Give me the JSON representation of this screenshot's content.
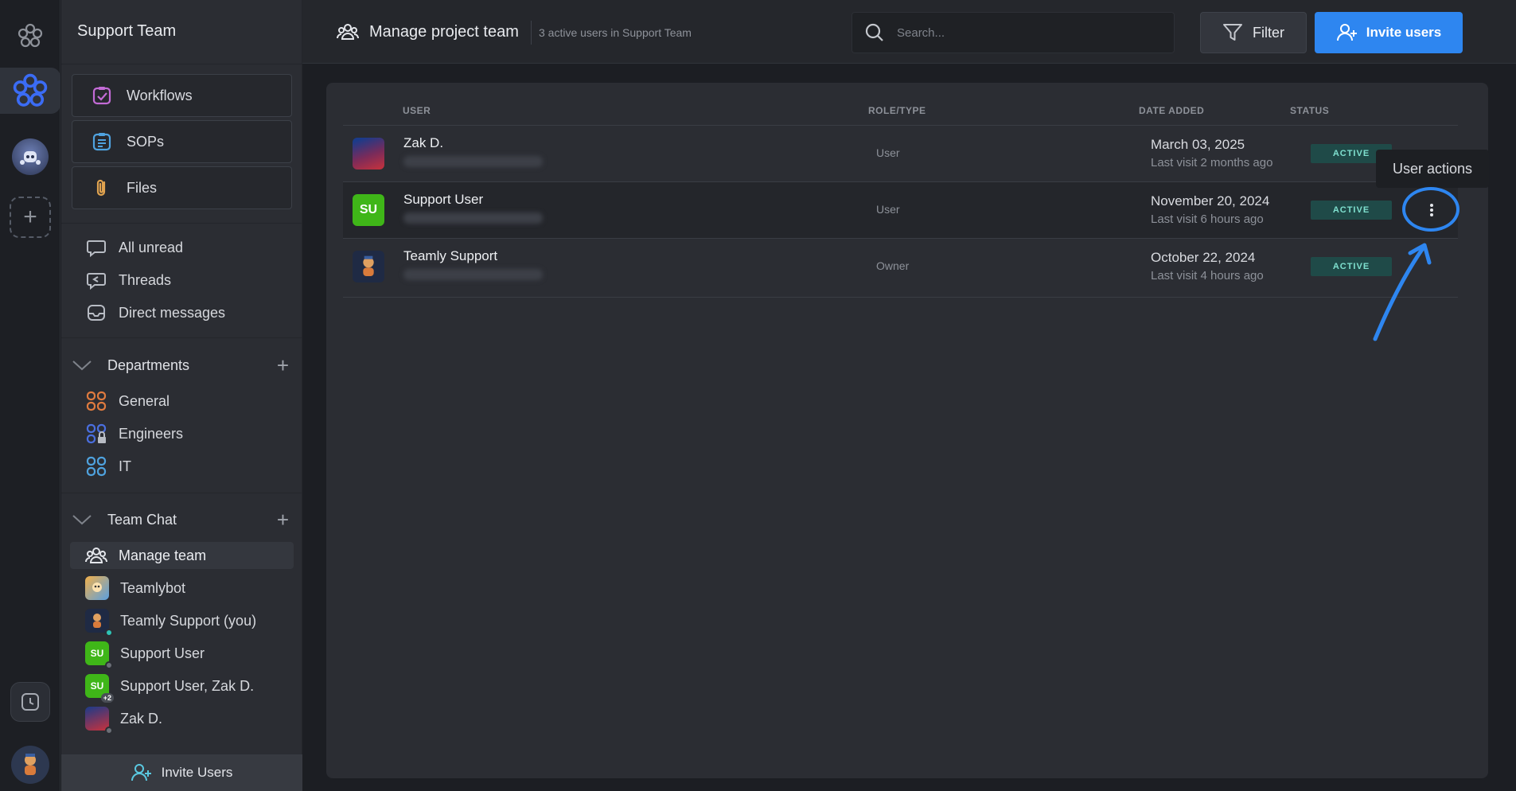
{
  "sidebar": {
    "team_name": "Support Team",
    "cards": [
      {
        "label": "Workflows",
        "icon": "workflows-icon",
        "color": "#c36bd6"
      },
      {
        "label": "SOPs",
        "icon": "sops-icon",
        "color": "#4fa3e0"
      },
      {
        "label": "Files",
        "icon": "paperclip-icon",
        "color": "#e0a34f"
      }
    ],
    "inbox": [
      {
        "label": "All unread",
        "icon": "chat-bubble-icon"
      },
      {
        "label": "Threads",
        "icon": "threads-icon"
      },
      {
        "label": "Direct messages",
        "icon": "inbox-icon"
      }
    ],
    "departments": {
      "title": "Departments",
      "items": [
        {
          "label": "General",
          "icon": "department-icon",
          "color": "#e07b3f"
        },
        {
          "label": "Engineers",
          "icon": "department-locked-icon",
          "color": "#4a6fe0"
        },
        {
          "label": "IT",
          "icon": "department-icon",
          "color": "#4fa3e0"
        }
      ]
    },
    "team_chat": {
      "title": "Team Chat",
      "items": [
        {
          "label": "Manage team",
          "kind": "icon"
        },
        {
          "label": "Teamlybot",
          "kind": "avatar"
        },
        {
          "label": "Teamly Support (you)",
          "kind": "avatar"
        },
        {
          "label": "Support User",
          "kind": "initials",
          "initials": "SU"
        },
        {
          "label": "Support User, Zak D.",
          "kind": "initials",
          "initials": "SU",
          "extra": "+2"
        },
        {
          "label": "Zak D.",
          "kind": "avatar"
        }
      ]
    },
    "footer_label": "Invite Users"
  },
  "header": {
    "title": "Manage project team",
    "subtitle": "3 active users in Support Team",
    "search_placeholder": "Search...",
    "filter_label": "Filter",
    "invite_label": "Invite users"
  },
  "table": {
    "columns": [
      "USER",
      "ROLE/TYPE",
      "DATE ADDED",
      "STATUS"
    ],
    "rows": [
      {
        "name": "Zak D.",
        "role": "User",
        "date": "March 03, 2025",
        "visit": "Last visit 2 months ago",
        "status": "ACTIVE"
      },
      {
        "name": "Support User",
        "initials": "SU",
        "role": "User",
        "date": "November 20, 2024",
        "visit": "Last visit 6 hours ago",
        "status": "ACTIVE"
      },
      {
        "name": "Teamly Support",
        "role": "Owner",
        "date": "October 22, 2024",
        "visit": "Last visit 4 hours ago",
        "status": "ACTIVE"
      }
    ]
  },
  "tooltip": "User actions",
  "colors": {
    "accent": "#2e86f0",
    "active_badge": "#1f4a48",
    "su_green": "#3fb618"
  }
}
